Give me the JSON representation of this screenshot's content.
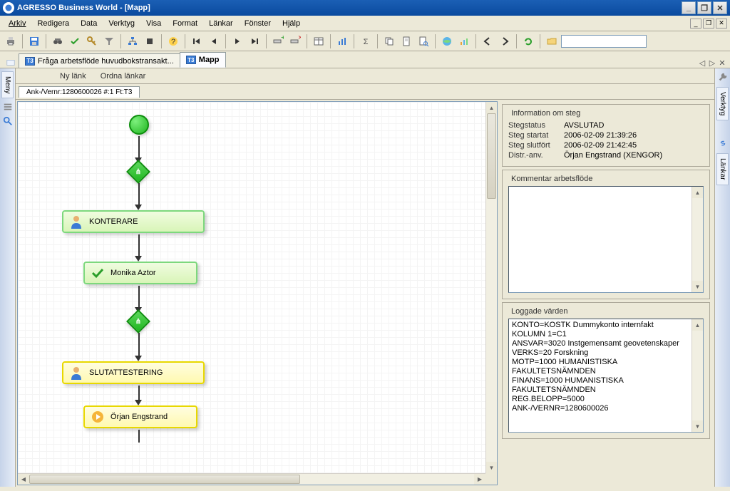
{
  "window": {
    "title": "AGRESSO Business World - [Mapp]"
  },
  "menu": [
    "Arkiv",
    "Redigera",
    "Data",
    "Verktyg",
    "Visa",
    "Format",
    "Länkar",
    "Fönster",
    "Hjälp"
  ],
  "tabs": {
    "items": [
      {
        "label": "Fråga arbetsflöde huvudbokstransakt..."
      },
      {
        "label": "Mapp"
      }
    ]
  },
  "subtoolbar": {
    "nylank": "Ny länk",
    "ordna": "Ordna länkar"
  },
  "breadcrumb": "Ank-/Vernr:1280600026 #:1 Ft:T3",
  "flow": {
    "box1": "KONTERARE",
    "box2": "Monika Aztor",
    "box3": "SLUTATTESTERING",
    "box4": "Örjan Engstrand"
  },
  "info": {
    "legend": "Information om steg",
    "rows": [
      {
        "lbl": "Stegstatus",
        "val": "AVSLUTAD"
      },
      {
        "lbl": "Steg startat",
        "val": "2006-02-09 21:39:26"
      },
      {
        "lbl": "Steg slutfört",
        "val": "2006-02-09 21:42:45"
      },
      {
        "lbl": "Distr.-anv.",
        "val": "Örjan Engstrand (XENGOR)"
      }
    ]
  },
  "kommentar": {
    "legend": "Kommentar arbetsflöde"
  },
  "loggade": {
    "legend": "Loggade värden",
    "text": "KONTO=KOSTK Dummykonto internfakt\nKOLUMN 1=C1\nANSVAR=3020 Instgemensamt geovetenskaper\nVERKS=20 Forskning\nMOTP=1000 HUMANISTISKA FAKULTETSNÄMNDEN\nFINANS=1000 HUMANISTISKA FAKULTETSNÄMNDEN\nREG.BELOPP=5000\nANK-/VERNR=1280600026"
  },
  "right_rail": {
    "verktyg": "Verktyg",
    "lankar": "Länkar"
  },
  "left_rail": {
    "meny": "Meny"
  }
}
